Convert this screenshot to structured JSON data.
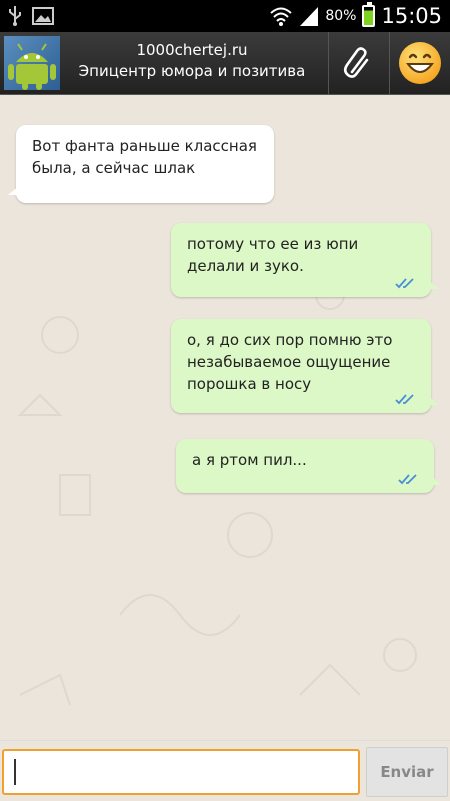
{
  "status_bar": {
    "battery_percent": "80%",
    "time": "15:05"
  },
  "header": {
    "title_line1": "1000chertej.ru",
    "title_line2": "Эпицентр юмора и позитива",
    "icons": {
      "avatar": "android-robot-icon",
      "attach": "paperclip-icon",
      "emoji": "smiley-face-icon"
    }
  },
  "messages": [
    {
      "direction": "incoming",
      "text": "Вот фанта раньше классная была, а сейчас шлак"
    },
    {
      "direction": "outgoing",
      "text": "потому что ее из юпи делали и зуко.",
      "status": "read"
    },
    {
      "direction": "outgoing",
      "text": "о, я до сих пор помню это незабываемое ощущение порошка в носу",
      "status": "read"
    },
    {
      "direction": "outgoing",
      "text": "а я ртом пил...",
      "status": "read"
    }
  ],
  "composer": {
    "input_value": "",
    "send_label": "Enviar"
  },
  "colors": {
    "chat_background": "#ece5dc",
    "outgoing_bubble": "#dcf8c6",
    "incoming_bubble": "#ffffff",
    "read_ticks": "#4a8fd6",
    "input_border": "#f0a030"
  }
}
